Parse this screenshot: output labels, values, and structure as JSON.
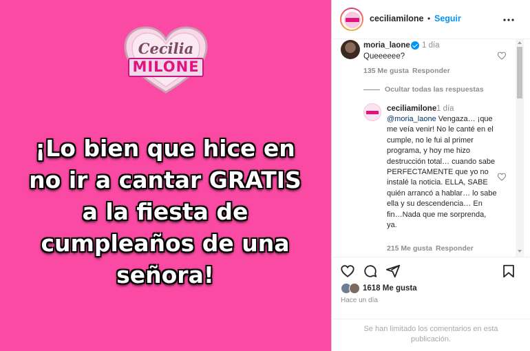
{
  "image": {
    "logo_line1": "Cecilia",
    "logo_line2": "MILONE",
    "headline": "¡Lo bien que hice en no ir a cantar GRATIS a la fiesta de cumpleaños de una señora!",
    "background_color": "#fb4aa4"
  },
  "header": {
    "username": "ceciliamilone",
    "separator": "•",
    "follow_label": "Seguir",
    "more_icon": "more-horizontal-icon"
  },
  "comments": [
    {
      "username": "moria_laone",
      "verified": true,
      "time": "1 día",
      "text": "Queeeeee?",
      "likes": "135 Me gusta",
      "reply_label": "Responder"
    }
  ],
  "replies_toggle": "Ocultar todas las respuestas",
  "reply": {
    "username": "ceciliamilone",
    "time": "1 día",
    "mention": "@moria_laone",
    "text": " Vengaza… ¡que me veía venir! No le canté en el cumple, no le fui al primer programa, y hoy me hizo destrucción total… cuando sabe PERFECTAMENTE que yo no instalé la noticia. ELLA, SABE quién arrancó a hablar… lo sabe ella y su descendencia… En fin…Nada que me sorprenda, ya.",
    "likes": "215 Me gusta",
    "reply_label": "Responder"
  },
  "actions": {
    "like_icon": "heart-icon",
    "comment_icon": "comment-icon",
    "share_icon": "share-icon",
    "save_icon": "bookmark-icon"
  },
  "likes_summary": "1618 Me gusta",
  "post_time": "Hace un día",
  "comments_limited": "Se han limitado los comentarios en esta publicación."
}
